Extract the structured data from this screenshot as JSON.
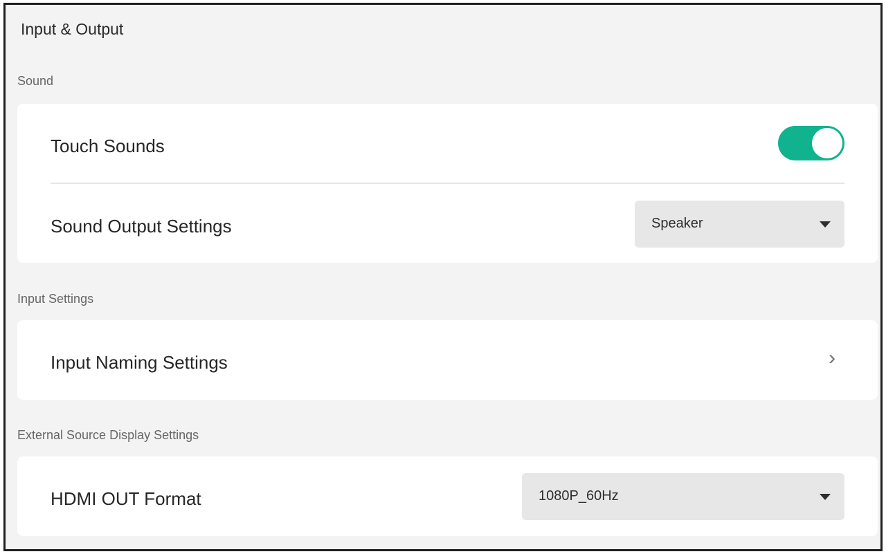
{
  "page": {
    "title": "Input & Output"
  },
  "sections": {
    "sound": {
      "label": "Sound",
      "touch_sounds": {
        "label": "Touch Sounds",
        "enabled": true
      },
      "sound_output": {
        "label": "Sound Output Settings",
        "value": "Speaker"
      }
    },
    "input": {
      "label": "Input Settings",
      "naming": {
        "label": "Input Naming Settings",
        "chevron": "›"
      }
    },
    "external": {
      "label": "External Source Display Settings",
      "hdmi_out": {
        "label": "HDMI OUT Format",
        "value": "1080P_60Hz"
      }
    }
  },
  "colors": {
    "accent": "#11b28e",
    "background": "#f3f3f3",
    "card": "#ffffff",
    "dropdown": "#e7e7e7"
  },
  "icons": {
    "toggle": "toggle-switch-on",
    "dropdown": "caret-down-icon",
    "navigate": "chevron-right-icon"
  }
}
